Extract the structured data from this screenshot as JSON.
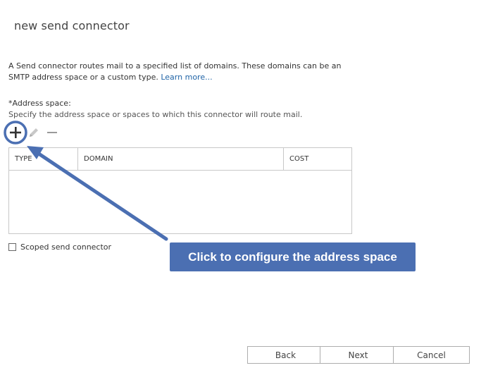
{
  "page": {
    "title": "new send connector"
  },
  "description": {
    "text": "A Send connector routes mail to a specified list of domains. These domains can be an SMTP address space or a custom type. ",
    "link_label": "Learn more..."
  },
  "address_space": {
    "label": "*Address space:",
    "help": "Specify the address space or spaces to which this connector will route mail.",
    "toolbar": {
      "add_icon": "plus-icon",
      "edit_icon": "pencil-icon",
      "remove_icon": "minus-icon"
    },
    "grid": {
      "columns": [
        "TYPE",
        "DOMAIN",
        "COST"
      ],
      "rows": []
    }
  },
  "scoped": {
    "label": "Scoped send connector",
    "checked": false
  },
  "callout": {
    "text": "Click to configure the address space",
    "color": "#4b6fb2"
  },
  "buttons": {
    "back": "Back",
    "next": "Next",
    "cancel": "Cancel"
  }
}
